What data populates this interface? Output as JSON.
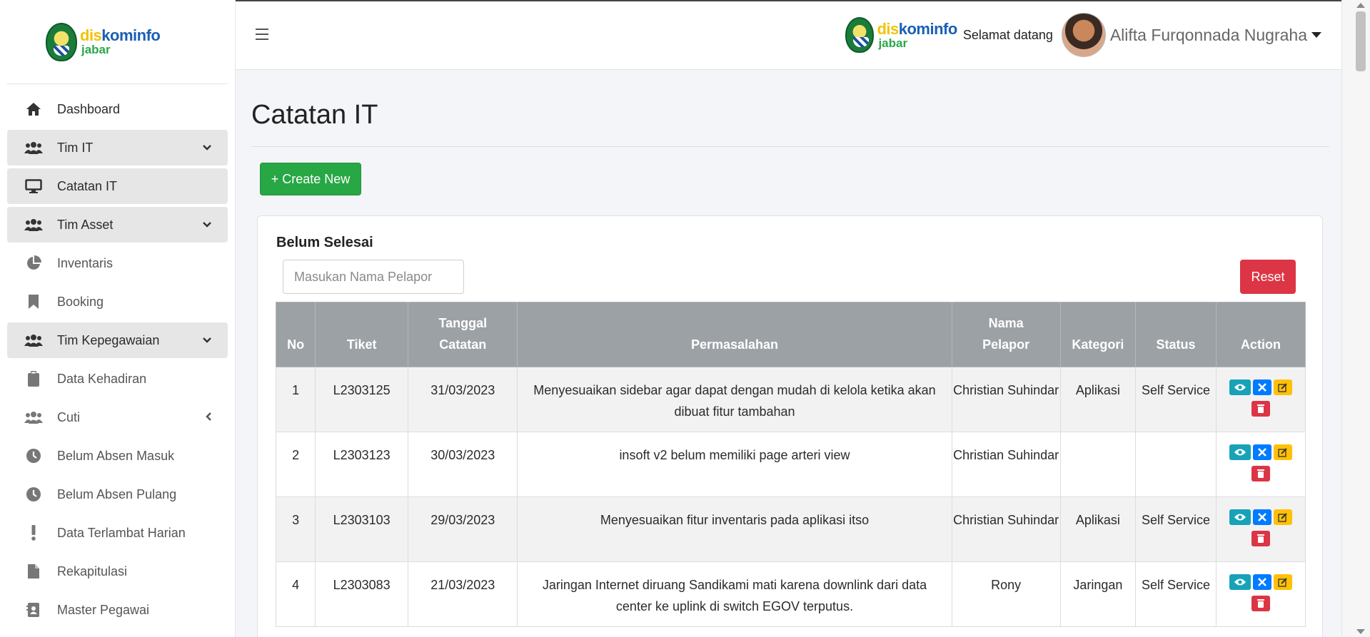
{
  "brand": {
    "dis": "dis",
    "kominfo": "kominfo",
    "region": "jabar"
  },
  "sidebar": {
    "items": [
      {
        "label": "Dashboard",
        "icon": "home-icon",
        "active": false,
        "caret": ""
      },
      {
        "label": "Tim IT",
        "icon": "users-icon",
        "active": true,
        "caret": "chevron-down"
      },
      {
        "label": "Catatan IT",
        "icon": "monitor-icon",
        "active": true,
        "caret": ""
      },
      {
        "label": "Tim Asset",
        "icon": "users-icon",
        "active": true,
        "caret": "chevron-down"
      },
      {
        "label": "Inventaris",
        "icon": "pie-chart-icon",
        "active": false,
        "caret": ""
      },
      {
        "label": "Booking",
        "icon": "bookmark-icon",
        "active": false,
        "caret": ""
      },
      {
        "label": "Tim Kepegawaian",
        "icon": "users-icon",
        "active": true,
        "caret": "chevron-down"
      },
      {
        "label": "Data Kehadiran",
        "icon": "clipboard-icon",
        "active": false,
        "caret": ""
      },
      {
        "label": "Cuti",
        "icon": "users-icon",
        "active": false,
        "caret": "chevron-left"
      },
      {
        "label": "Belum Absen Masuk",
        "icon": "clock-icon",
        "active": false,
        "caret": ""
      },
      {
        "label": "Belum Absen Pulang",
        "icon": "clock-icon",
        "active": false,
        "caret": ""
      },
      {
        "label": "Data Terlambat Harian",
        "icon": "exclamation-icon",
        "active": false,
        "caret": ""
      },
      {
        "label": "Rekapitulasi",
        "icon": "file-icon",
        "active": false,
        "caret": ""
      },
      {
        "label": "Master Pegawai",
        "icon": "address-book-icon",
        "active": false,
        "caret": ""
      }
    ]
  },
  "header": {
    "welcome": "Selamat datang",
    "username": "Alifta Furqonnada Nugraha"
  },
  "page": {
    "title": "Catatan IT",
    "create_label": "+ Create New"
  },
  "card": {
    "title": "Belum Selesai",
    "search_placeholder": "Masukan Nama Pelapor",
    "reset_label": "Reset"
  },
  "table": {
    "headers": {
      "no": "No",
      "tiket": "Tiket",
      "tanggal_1": "Tanggal",
      "tanggal_2": "Catatan",
      "permasalahan": "Permasalahan",
      "pelapor_1": "Nama",
      "pelapor_2": "Pelapor",
      "kategori": "Kategori",
      "status": "Status",
      "action": "Action"
    },
    "rows": [
      {
        "no": "1",
        "tiket": "L2303125",
        "tanggal": "31/03/2023",
        "permasalahan": "Menyesuaikan sidebar agar dapat dengan mudah di kelola ketika akan dibuat fitur tambahan",
        "pelapor": "Christian Suhindar",
        "kategori": "Aplikasi",
        "status": "Self Service"
      },
      {
        "no": "2",
        "tiket": "L2303123",
        "tanggal": "30/03/2023",
        "permasalahan": "insoft v2 belum memiliki page arteri view",
        "pelapor": "Christian Suhindar",
        "kategori": "",
        "status": ""
      },
      {
        "no": "3",
        "tiket": "L2303103",
        "tanggal": "29/03/2023",
        "permasalahan": "Menyesuaikan fitur inventaris pada aplikasi itso",
        "pelapor": "Christian Suhindar",
        "kategori": "Aplikasi",
        "status": "Self Service"
      },
      {
        "no": "4",
        "tiket": "L2303083",
        "tanggal": "21/03/2023",
        "permasalahan": "Jaringan Internet diruang Sandikami mati karena downlink dari data center ke uplink di switch EGOV terputus.",
        "pelapor": "Rony",
        "kategori": "Jaringan",
        "status": "Self Service"
      }
    ]
  },
  "colors": {
    "success": "#28a745",
    "danger": "#dc3545",
    "info": "#17a2b8",
    "primary": "#007bff",
    "warning": "#ffc107",
    "table_header": "#9ca1a6"
  }
}
